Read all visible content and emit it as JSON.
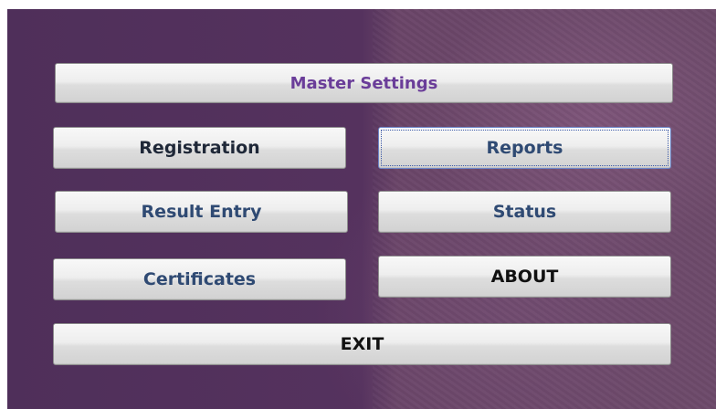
{
  "menu": {
    "master_settings": "Master Settings",
    "registration": "Registration",
    "reports": "Reports",
    "result_entry": "Result Entry",
    "status": "Status",
    "certificates": "Certificates",
    "about": "ABOUT",
    "exit": "EXIT"
  },
  "colors": {
    "background": "#55325e",
    "master_text": "#6a3d99",
    "blue_text": "#2f4a73",
    "dark_text": "#111111"
  }
}
